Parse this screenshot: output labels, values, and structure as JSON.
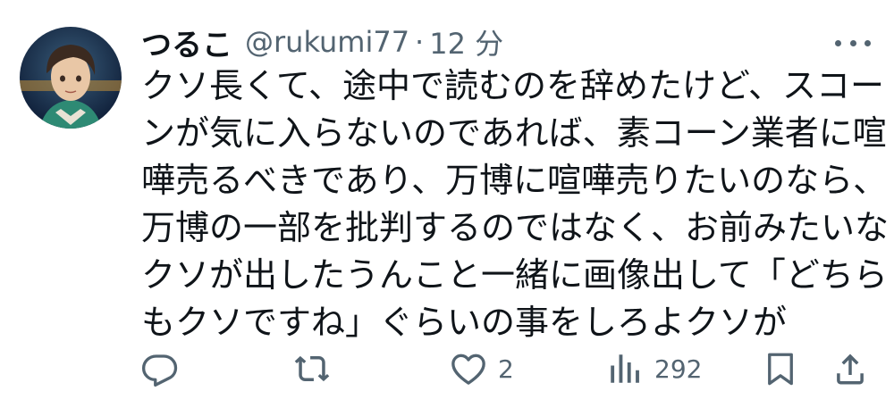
{
  "tweet": {
    "author": {
      "display_name": "つるこ",
      "handle": "@rukumi77",
      "separator": "·",
      "time_ago": "12 分"
    },
    "text_lines": [
      "クソ長くて、途中で読むのを辞めたけど、スコー",
      "ンが気に入らないのであれば、素コーン業者に喧",
      "嘩売るべきであり、万博に喧嘩売りたいのなら、",
      "万博の一部を批判するのではなく、お前みたいな",
      "クソが出したうんこと一緒に画像出して「どちら",
      "もクソですね」ぐらいの事をしろよクソが"
    ],
    "actions": {
      "reply_count": "",
      "retweet_count": "",
      "like_count": "2",
      "views_count": "292"
    }
  },
  "icons": {
    "more": "more-horizontal-icon",
    "reply": "reply-icon",
    "retweet": "retweet-icon",
    "like": "heart-icon",
    "views": "views-chart-icon",
    "bookmark": "bookmark-icon",
    "share": "share-icon"
  },
  "colors": {
    "text_primary": "#0f1419",
    "text_secondary": "#536471",
    "background": "#ffffff"
  }
}
